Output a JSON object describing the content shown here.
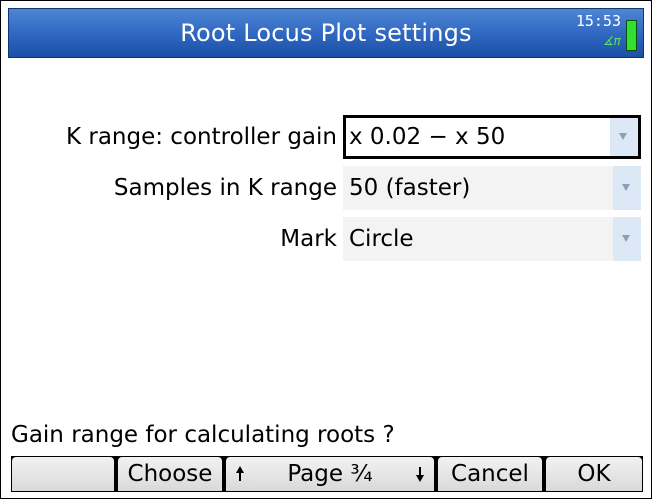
{
  "window": {
    "title": "Root Locus Plot settings",
    "clock": "15:53",
    "angle_indicator": "∡π"
  },
  "fields": [
    {
      "label": "K range: controller gain",
      "value": "x 0.02 − x 50",
      "focused": true
    },
    {
      "label": "Samples in K range",
      "value": "50 (faster)",
      "focused": false
    },
    {
      "label": "Mark",
      "value": "Circle",
      "focused": false
    }
  ],
  "help_text": "Gain range for calculating roots ?",
  "softkeys": {
    "key1": "",
    "choose": "Choose",
    "page": "Page ¾",
    "cancel": "Cancel",
    "ok": "OK"
  }
}
